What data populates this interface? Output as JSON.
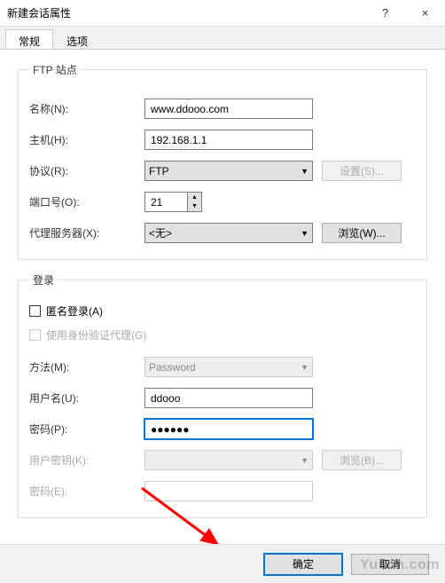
{
  "window": {
    "title": "新建会话属性",
    "help": "?",
    "close": "×"
  },
  "tabs": {
    "general": "常规",
    "options": "选项"
  },
  "ftp_site": {
    "legend": "FTP 站点",
    "name_label": "名称(N):",
    "name_value": "www.ddooo.com",
    "host_label": "主机(H):",
    "host_value": "192.168.1.1",
    "protocol_label": "协议(R):",
    "protocol_value": "FTP",
    "settings_btn": "设置(S)...",
    "port_label": "端口号(O):",
    "port_value": "21",
    "proxy_label": "代理服务器(X):",
    "proxy_value": "<无>",
    "browse_btn": "浏览(W)..."
  },
  "login": {
    "legend": "登录",
    "anon_label": "匿名登录(A)",
    "authproxy_label": "使用身份验证代理(G)",
    "method_label": "方法(M):",
    "method_value": "Password",
    "user_label": "用户名(U):",
    "user_value": "ddooo",
    "pass_label": "密码(P):",
    "pass_value": "●●●●●●",
    "userkey_label": "用户密钥(K):",
    "browse2_btn": "浏览(B)...",
    "passphrase_label": "密码(E):"
  },
  "footer": {
    "ok": "确定",
    "cancel": "取消"
  },
  "watermark": "Yuucn.com"
}
